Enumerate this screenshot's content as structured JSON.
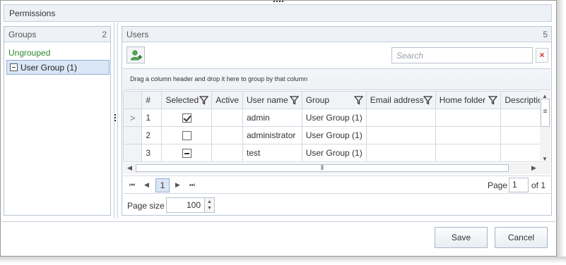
{
  "permissions": {
    "title": "Permissions"
  },
  "groups": {
    "title": "Groups",
    "count": "2",
    "ungrouped_label": "Ungrouped",
    "items": [
      {
        "label": "User Group (1)"
      }
    ]
  },
  "users": {
    "title": "Users",
    "count": "5",
    "search_placeholder": "Search",
    "clear_label": "×",
    "group_hint": "Drag a column header and drop it here to group by that column",
    "columns": [
      "#",
      "Selected",
      "Active",
      "User name",
      "Group",
      "Email address",
      "Home folder",
      "Descriptio"
    ],
    "rows": [
      {
        "indicator": ">",
        "num": "1",
        "selected": "checked",
        "active": "",
        "username": "admin",
        "group": "User Group (1)",
        "email": "",
        "home": "",
        "desc": ""
      },
      {
        "indicator": "",
        "num": "2",
        "selected": "unchecked",
        "active": "",
        "username": "administrator",
        "group": "User Group (1)",
        "email": "",
        "home": "",
        "desc": ""
      },
      {
        "indicator": "",
        "num": "3",
        "selected": "indeterminate",
        "active": "",
        "username": "test",
        "group": "User Group (1)",
        "email": "",
        "home": "",
        "desc": ""
      }
    ]
  },
  "pager": {
    "current_page": "1",
    "page_label": "Page",
    "page_input": "1",
    "of_label": "of 1",
    "page_size_label": "Page size",
    "page_size": "100"
  },
  "buttons": {
    "save": "Save",
    "cancel": "Cancel"
  },
  "colors": {
    "accent": "#2e8b2e",
    "selection": "#d9e6f5",
    "clear_icon": "#d32f2f"
  }
}
